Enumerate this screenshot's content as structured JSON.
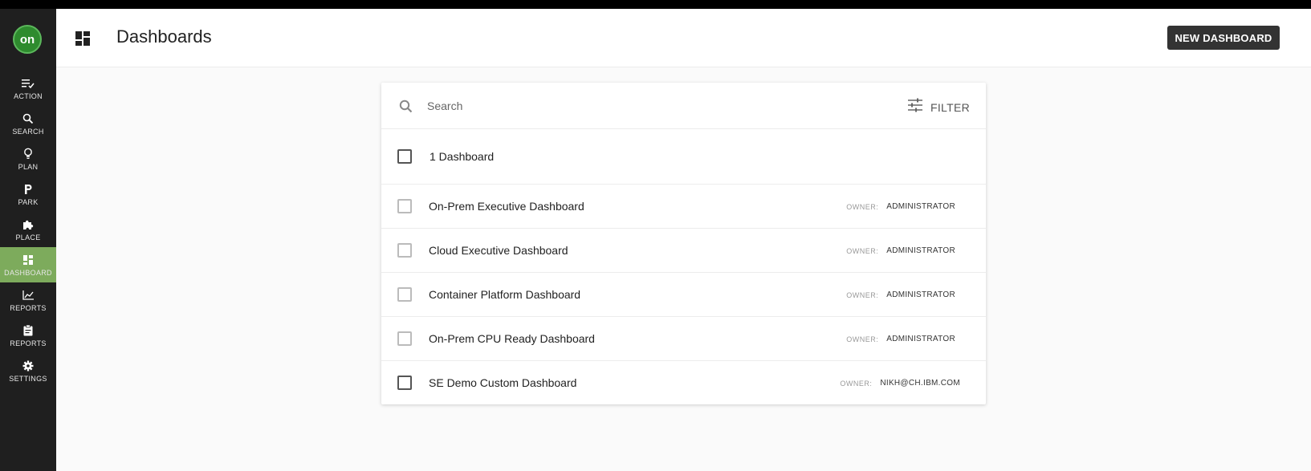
{
  "app": {
    "logo_text": "on"
  },
  "sidebar": {
    "items": [
      {
        "label": "ACTION",
        "icon": "action-icon",
        "active": false
      },
      {
        "label": "SEARCH",
        "icon": "search-icon",
        "active": false
      },
      {
        "label": "PLAN",
        "icon": "lightbulb-icon",
        "active": false
      },
      {
        "label": "PARK",
        "icon": "park-icon",
        "active": false
      },
      {
        "label": "PLACE",
        "icon": "puzzle-icon",
        "active": false
      },
      {
        "label": "DASHBOARD",
        "icon": "dashboard-icon",
        "active": true
      },
      {
        "label": "REPORTS",
        "icon": "chart-icon",
        "active": false
      },
      {
        "label": "REPORTS",
        "icon": "clipboard-icon",
        "active": false
      },
      {
        "label": "SETTINGS",
        "icon": "gear-icon",
        "active": false
      }
    ]
  },
  "header": {
    "title": "Dashboards",
    "new_button_label": "NEW DASHBOARD"
  },
  "search": {
    "placeholder": "Search",
    "filter_label": "FILTER"
  },
  "summary": {
    "text": "1 Dashboard"
  },
  "dashboards": [
    {
      "name": "On-Prem Executive Dashboard",
      "owner_label": "OWNER:",
      "owner": "ADMINISTRATOR"
    },
    {
      "name": "Cloud Executive Dashboard",
      "owner_label": "OWNER:",
      "owner": "ADMINISTRATOR"
    },
    {
      "name": "Container Platform Dashboard",
      "owner_label": "OWNER:",
      "owner": "ADMINISTRATOR"
    },
    {
      "name": "On-Prem CPU Ready Dashboard",
      "owner_label": "OWNER:",
      "owner": "ADMINISTRATOR"
    },
    {
      "name": "SE Demo Custom Dashboard",
      "owner_label": "OWNER:",
      "owner": "NIKH@CH.IBM.COM"
    }
  ],
  "colors": {
    "sidebar_bg": "#1f1f1f",
    "active_nav": "#7dab5c",
    "logo_green": "#2e8b2e",
    "button_bg": "#333333"
  }
}
